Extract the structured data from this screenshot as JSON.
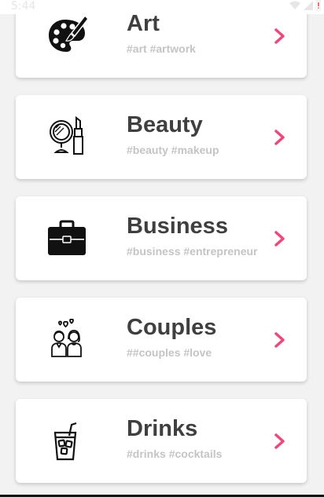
{
  "status_bar": {
    "time": "5:44"
  },
  "colors": {
    "accent": "#f0467a",
    "title": "#3f3f3f",
    "tags": "#c4c4c4",
    "background": "#f2f2f2"
  },
  "categories": [
    {
      "title": "Art",
      "tags": "#art #artwork",
      "icon": "palette-icon"
    },
    {
      "title": "Beauty",
      "tags": "#beauty #makeup",
      "icon": "mirror-lipstick-icon"
    },
    {
      "title": "Business",
      "tags": "#business #entrepreneur",
      "icon": "briefcase-icon"
    },
    {
      "title": "Couples",
      "tags": "##couples #love",
      "icon": "couple-icon"
    },
    {
      "title": "Drinks",
      "tags": "#drinks #cocktails",
      "icon": "cocktail-icon"
    }
  ]
}
